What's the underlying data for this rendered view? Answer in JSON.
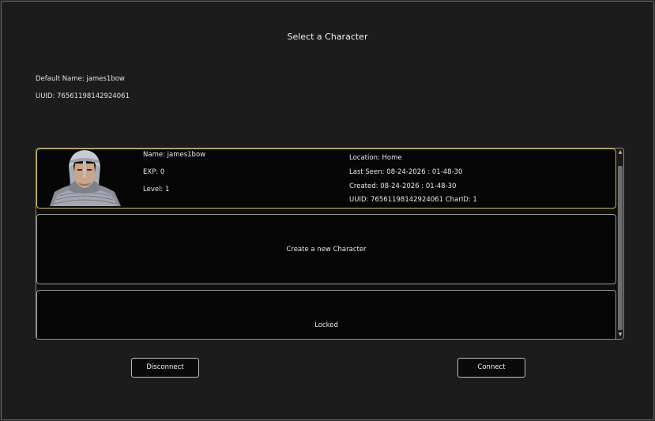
{
  "window": {
    "title": "Select a Character"
  },
  "account": {
    "default_name": "Default Name: james1bow",
    "uuid": "UUID: 76561198142924061"
  },
  "characters": [
    {
      "portrait_icon": "knight-portrait-icon",
      "name": "Name: james1bow",
      "exp": "EXP: 0",
      "level": "Level: 1",
      "location": "Location: Home",
      "last_seen": "Last Seen: 08-24-2026 : 01-48-30",
      "created": "Created: 08-24-2026 : 01-48-30",
      "uuid_charid": "UUID: 76561198142924061  CharID: 1"
    }
  ],
  "create_slot": {
    "label": "Create a new Character"
  },
  "locked_slot": {
    "label": "Locked"
  },
  "buttons": {
    "disconnect": "Disconnect",
    "connect": "Connect"
  },
  "colors": {
    "selected_border": "#d6b84a",
    "background": "#1c1c1c"
  }
}
